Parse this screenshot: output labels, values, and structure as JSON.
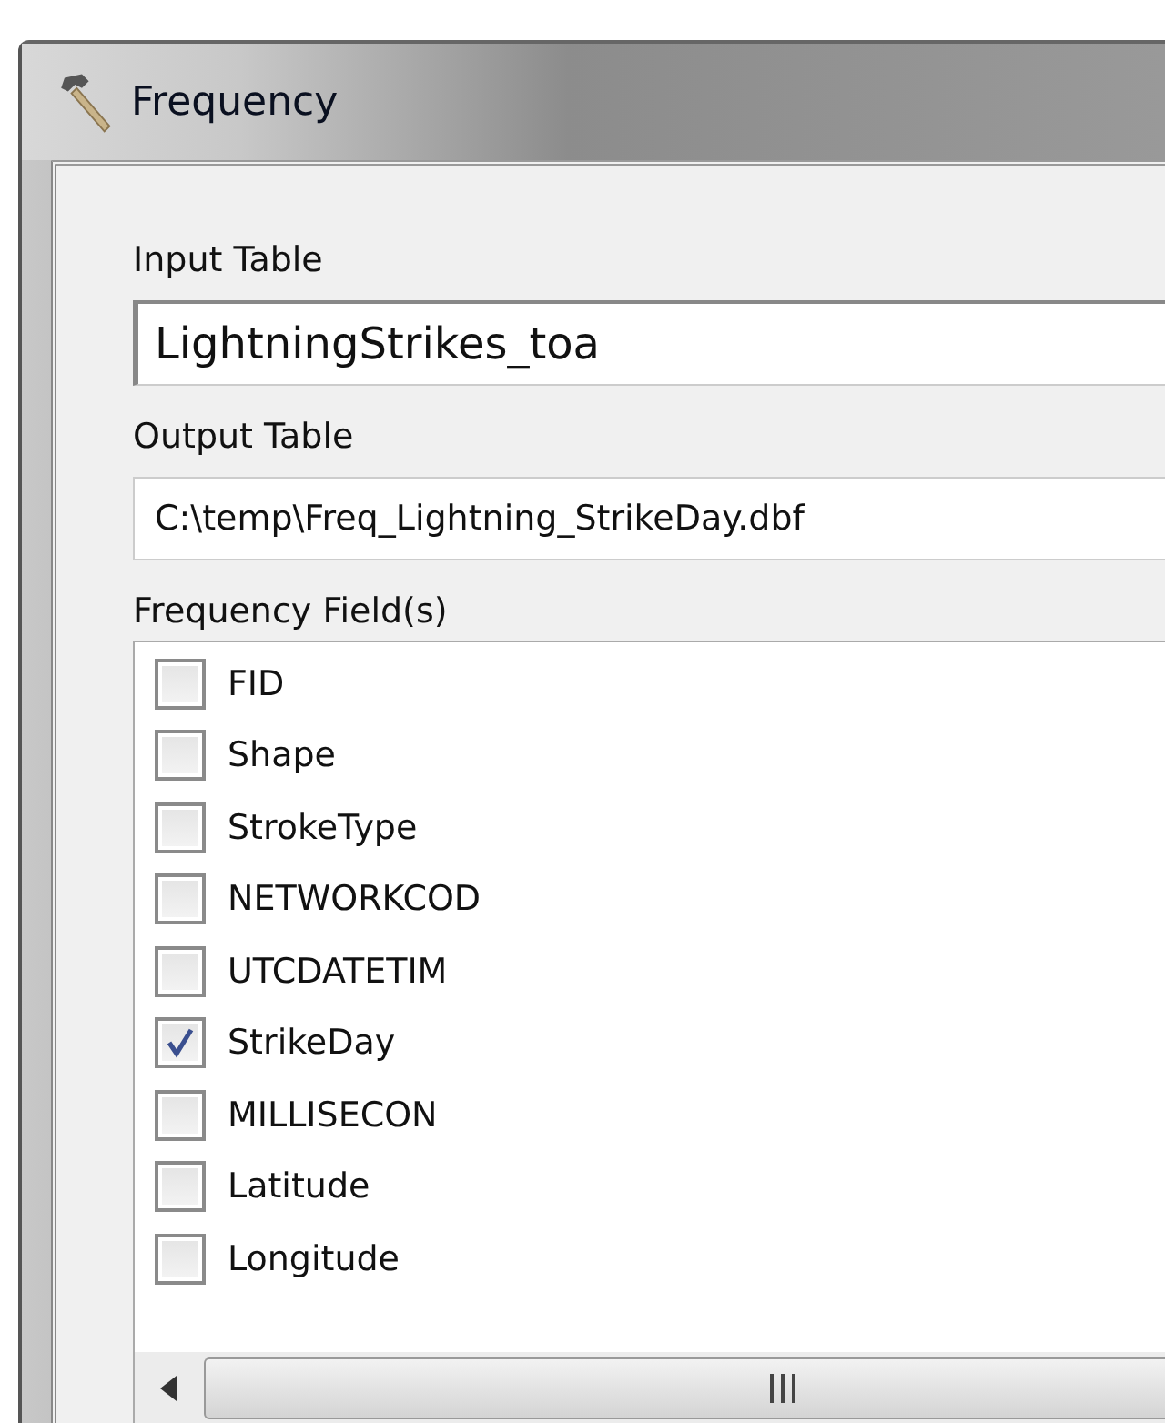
{
  "window": {
    "title": "Frequency"
  },
  "input_table": {
    "label": "Input Table",
    "value": "LightningStrikes_toa"
  },
  "output_table": {
    "label": "Output Table",
    "value": "C:\\temp\\Freq_Lightning_StrikeDay.dbf"
  },
  "frequency_fields": {
    "label": "Frequency Field(s)",
    "items": [
      {
        "label": "FID",
        "checked": false
      },
      {
        "label": "Shape",
        "checked": false
      },
      {
        "label": "StrokeType",
        "checked": false
      },
      {
        "label": "NETWORKCOD",
        "checked": false
      },
      {
        "label": "UTCDATETIM",
        "checked": false
      },
      {
        "label": "StrikeDay",
        "checked": true
      },
      {
        "label": "MILLISECON",
        "checked": false
      },
      {
        "label": "Latitude",
        "checked": false
      },
      {
        "label": "Longitude",
        "checked": false
      }
    ]
  }
}
